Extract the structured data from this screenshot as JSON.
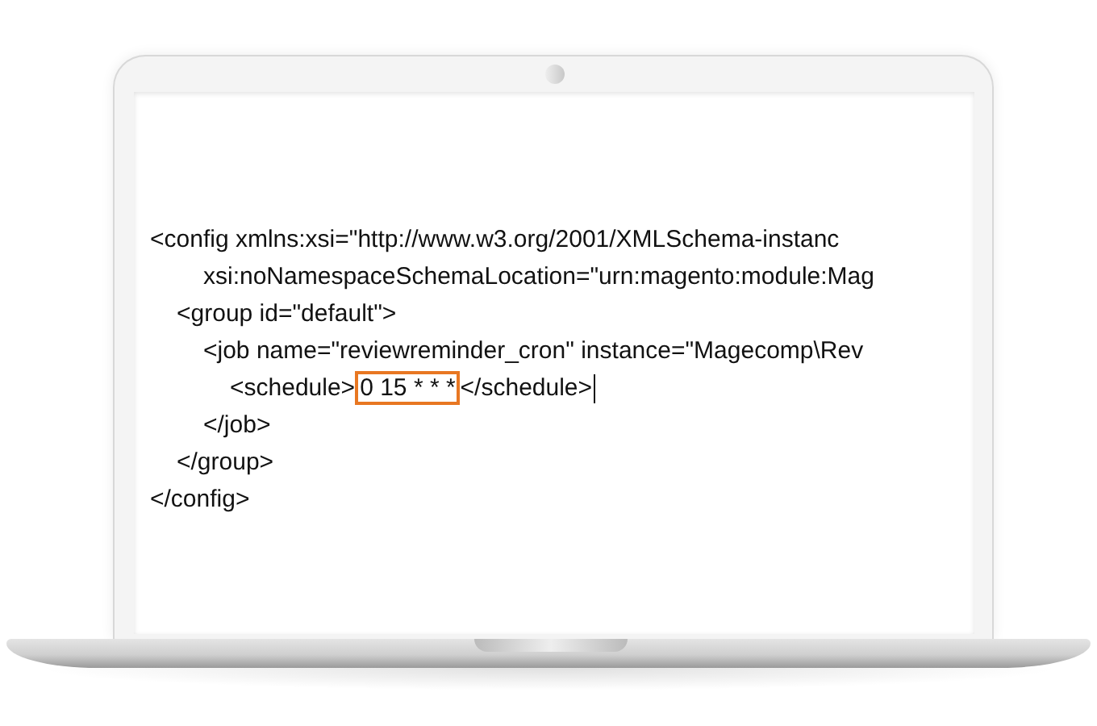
{
  "code_lines": [
    {
      "kind": "tag",
      "segments": [
        {
          "text": "<config xmlns:xsi=\"http://www.w3.org/2001/XMLSchema-instanc",
          "highlighted": false
        }
      ],
      "children": [
        {
          "kind": "continuation",
          "segments": [
            {
              "text": "xsi:noNamespaceSchemaLocation=\"urn:magento:module:Mag",
              "highlighted": false
            }
          ]
        },
        {
          "kind": "tag",
          "segments": [
            {
              "text": "<group id=\"default\">",
              "highlighted": false
            }
          ],
          "children": [
            {
              "kind": "tag",
              "segments": [
                {
                  "text": "<job name=\"reviewreminder_cron\" instance=\"Magecomp\\Rev",
                  "highlighted": false
                }
              ],
              "children": [
                {
                  "kind": "tag",
                  "cursor": true,
                  "segments": [
                    {
                      "text": "<schedule>",
                      "highlighted": false
                    },
                    {
                      "text": "0 15 * * *",
                      "highlighted": true
                    },
                    {
                      "text": "</schedule>",
                      "highlighted": false
                    }
                  ]
                }
              ]
            },
            {
              "kind": "tag",
              "segments": [
                {
                  "text": "</job>",
                  "highlighted": false
                }
              ]
            }
          ]
        },
        {
          "kind": "tag",
          "segments": [
            {
              "text": "</group>",
              "highlighted": false
            }
          ]
        }
      ]
    },
    {
      "kind": "tag",
      "segments": [
        {
          "text": "</config>",
          "highlighted": false
        }
      ]
    }
  ]
}
